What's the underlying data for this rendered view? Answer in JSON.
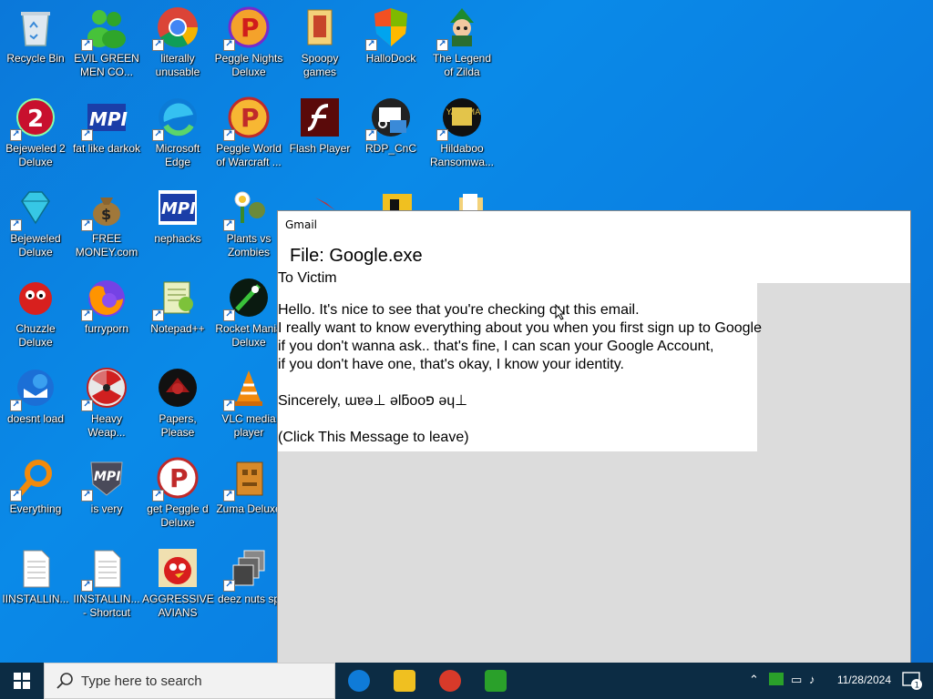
{
  "desktop": {
    "icons": [
      {
        "label": "Recycle Bin"
      },
      {
        "label": "EVIL GREEN\nMEN CO..."
      },
      {
        "label": "literally\nunusable"
      },
      {
        "label": "Peggle Nights\nDeluxe"
      },
      {
        "label": "Spoopy\ngames"
      },
      {
        "label": "HalloDock"
      },
      {
        "label": "The Legend\nof Zilda"
      },
      {
        "label": "Bejeweled 2\nDeluxe"
      },
      {
        "label": "fat like darkok"
      },
      {
        "label": "Microsoft\nEdge"
      },
      {
        "label": "Peggle World\nof Warcraft ..."
      },
      {
        "label": "Flash Player"
      },
      {
        "label": "RDP_CnC"
      },
      {
        "label": "Hildaboo\nRansomwa..."
      },
      {
        "label": "Bejeweled\nDeluxe"
      },
      {
        "label": "FREE\nMONEY.com"
      },
      {
        "label": "nephacks"
      },
      {
        "label": "Plants vs\nZombies"
      },
      {
        "label": "Chuzzle\nDeluxe"
      },
      {
        "label": "furryporn"
      },
      {
        "label": "Notepad++"
      },
      {
        "label": "Rocket Mania\nDeluxe"
      },
      {
        "label": "doesnt load"
      },
      {
        "label": "Heavy\nWeap..."
      },
      {
        "label": "Papers, Please"
      },
      {
        "label": "VLC media\nplayer"
      },
      {
        "label": "Everything"
      },
      {
        "label": "is very"
      },
      {
        "label": "get Peggle d\nDeluxe"
      },
      {
        "label": "Zuma Deluxe"
      },
      {
        "label": "IINSTALLIN..."
      },
      {
        "label": "IINSTALLIN...\n- Shortcut"
      },
      {
        "label": "AGGRESSIVE\nAVIANS"
      },
      {
        "label": "deez nuts sp"
      }
    ]
  },
  "popup": {
    "title": "Gmail",
    "file_line": "File: Google.exe",
    "to_line": "To Victim",
    "body": [
      "Hello. It's nice to see that you're checking out this email.",
      "I really want to know everything about you when you first sign up to Google",
      "if you don't wanna ask.. that's fine, I can scan your Google Account,",
      "if you don't have one, that's okay, I know your identity.",
      "Sincerely, ɯɐǝ⊥ ǝlƃooפ ǝɥ⊥",
      "(Click This Message to leave)"
    ]
  },
  "taskbar": {
    "search_placeholder": "Type here to search",
    "clock": "11/28/2024",
    "notification_count": "1"
  },
  "colors": {
    "desktop_bg": "#0a84e0",
    "taskbar_bg": "#0c2c44",
    "popup_bg": "#dcdcdc"
  }
}
